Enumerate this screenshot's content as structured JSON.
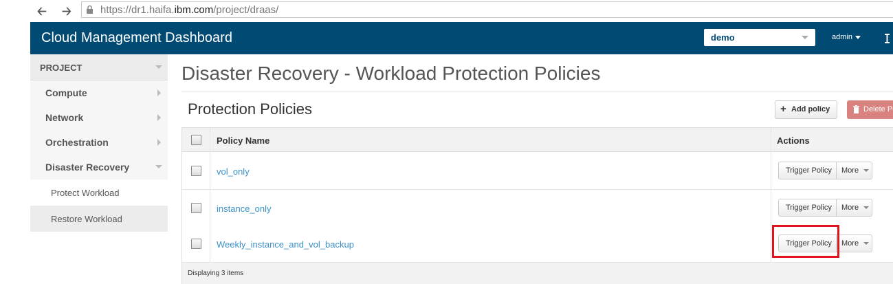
{
  "browser": {
    "url_prefix": "https://dr1.haifa.",
    "url_domain": "ibm.com",
    "url_suffix": "/project/draas/"
  },
  "header": {
    "brand": "Cloud Management Dashboard",
    "project_select": "demo",
    "user_menu": "admin"
  },
  "sidebar": {
    "section": "PROJECT",
    "items": [
      {
        "label": "Compute"
      },
      {
        "label": "Network"
      },
      {
        "label": "Orchestration"
      },
      {
        "label": "Disaster Recovery"
      }
    ],
    "subitems": [
      {
        "label": "Protect Workload",
        "active": true
      },
      {
        "label": "Restore Workload",
        "active": false
      }
    ]
  },
  "main": {
    "page_title": "Disaster Recovery - Workload Protection Policies",
    "section_title": "Protection Policies",
    "add_button": "Add policy",
    "delete_button": "Delete Policies"
  },
  "table": {
    "columns": [
      "Policy Name",
      "Actions"
    ],
    "rows": [
      {
        "name": "vol_only",
        "action": "Trigger Policy",
        "more": "More"
      },
      {
        "name": "instance_only",
        "action": "Trigger Policy",
        "more": "More"
      },
      {
        "name": "Weekly_instance_and_vol_backup",
        "action": "Trigger Policy",
        "more": "More"
      }
    ],
    "footer": "Displaying 3 items"
  },
  "colors": {
    "header_bg": "#004a74",
    "link": "#3a91c7",
    "delete_bg": "#d9827f",
    "highlight": "#e0141c"
  }
}
